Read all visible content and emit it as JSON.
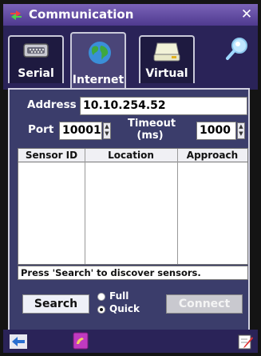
{
  "window": {
    "title": "Communication"
  },
  "tabs": [
    {
      "label": "Serial"
    },
    {
      "label": "Internet"
    },
    {
      "label": "Virtual"
    }
  ],
  "form": {
    "address_label": "Address",
    "address_value": "10.10.254.52",
    "port_label": "Port",
    "port_value": "10001",
    "timeout_label_line1": "Timeout",
    "timeout_label_line2": "(ms)",
    "timeout_value": "1000"
  },
  "table": {
    "columns": [
      "Sensor ID",
      "Location",
      "Approach"
    ]
  },
  "status": {
    "text": "Press 'Search' to discover sensors."
  },
  "buttons": {
    "search": "Search",
    "connect": "Connect"
  },
  "radio": {
    "full": "Full",
    "quick": "Quick",
    "selected": "Quick"
  },
  "colors": {
    "title_bar": "#5b46a3",
    "panel": "#3b3d6b",
    "tab_active": "#4a4578"
  }
}
